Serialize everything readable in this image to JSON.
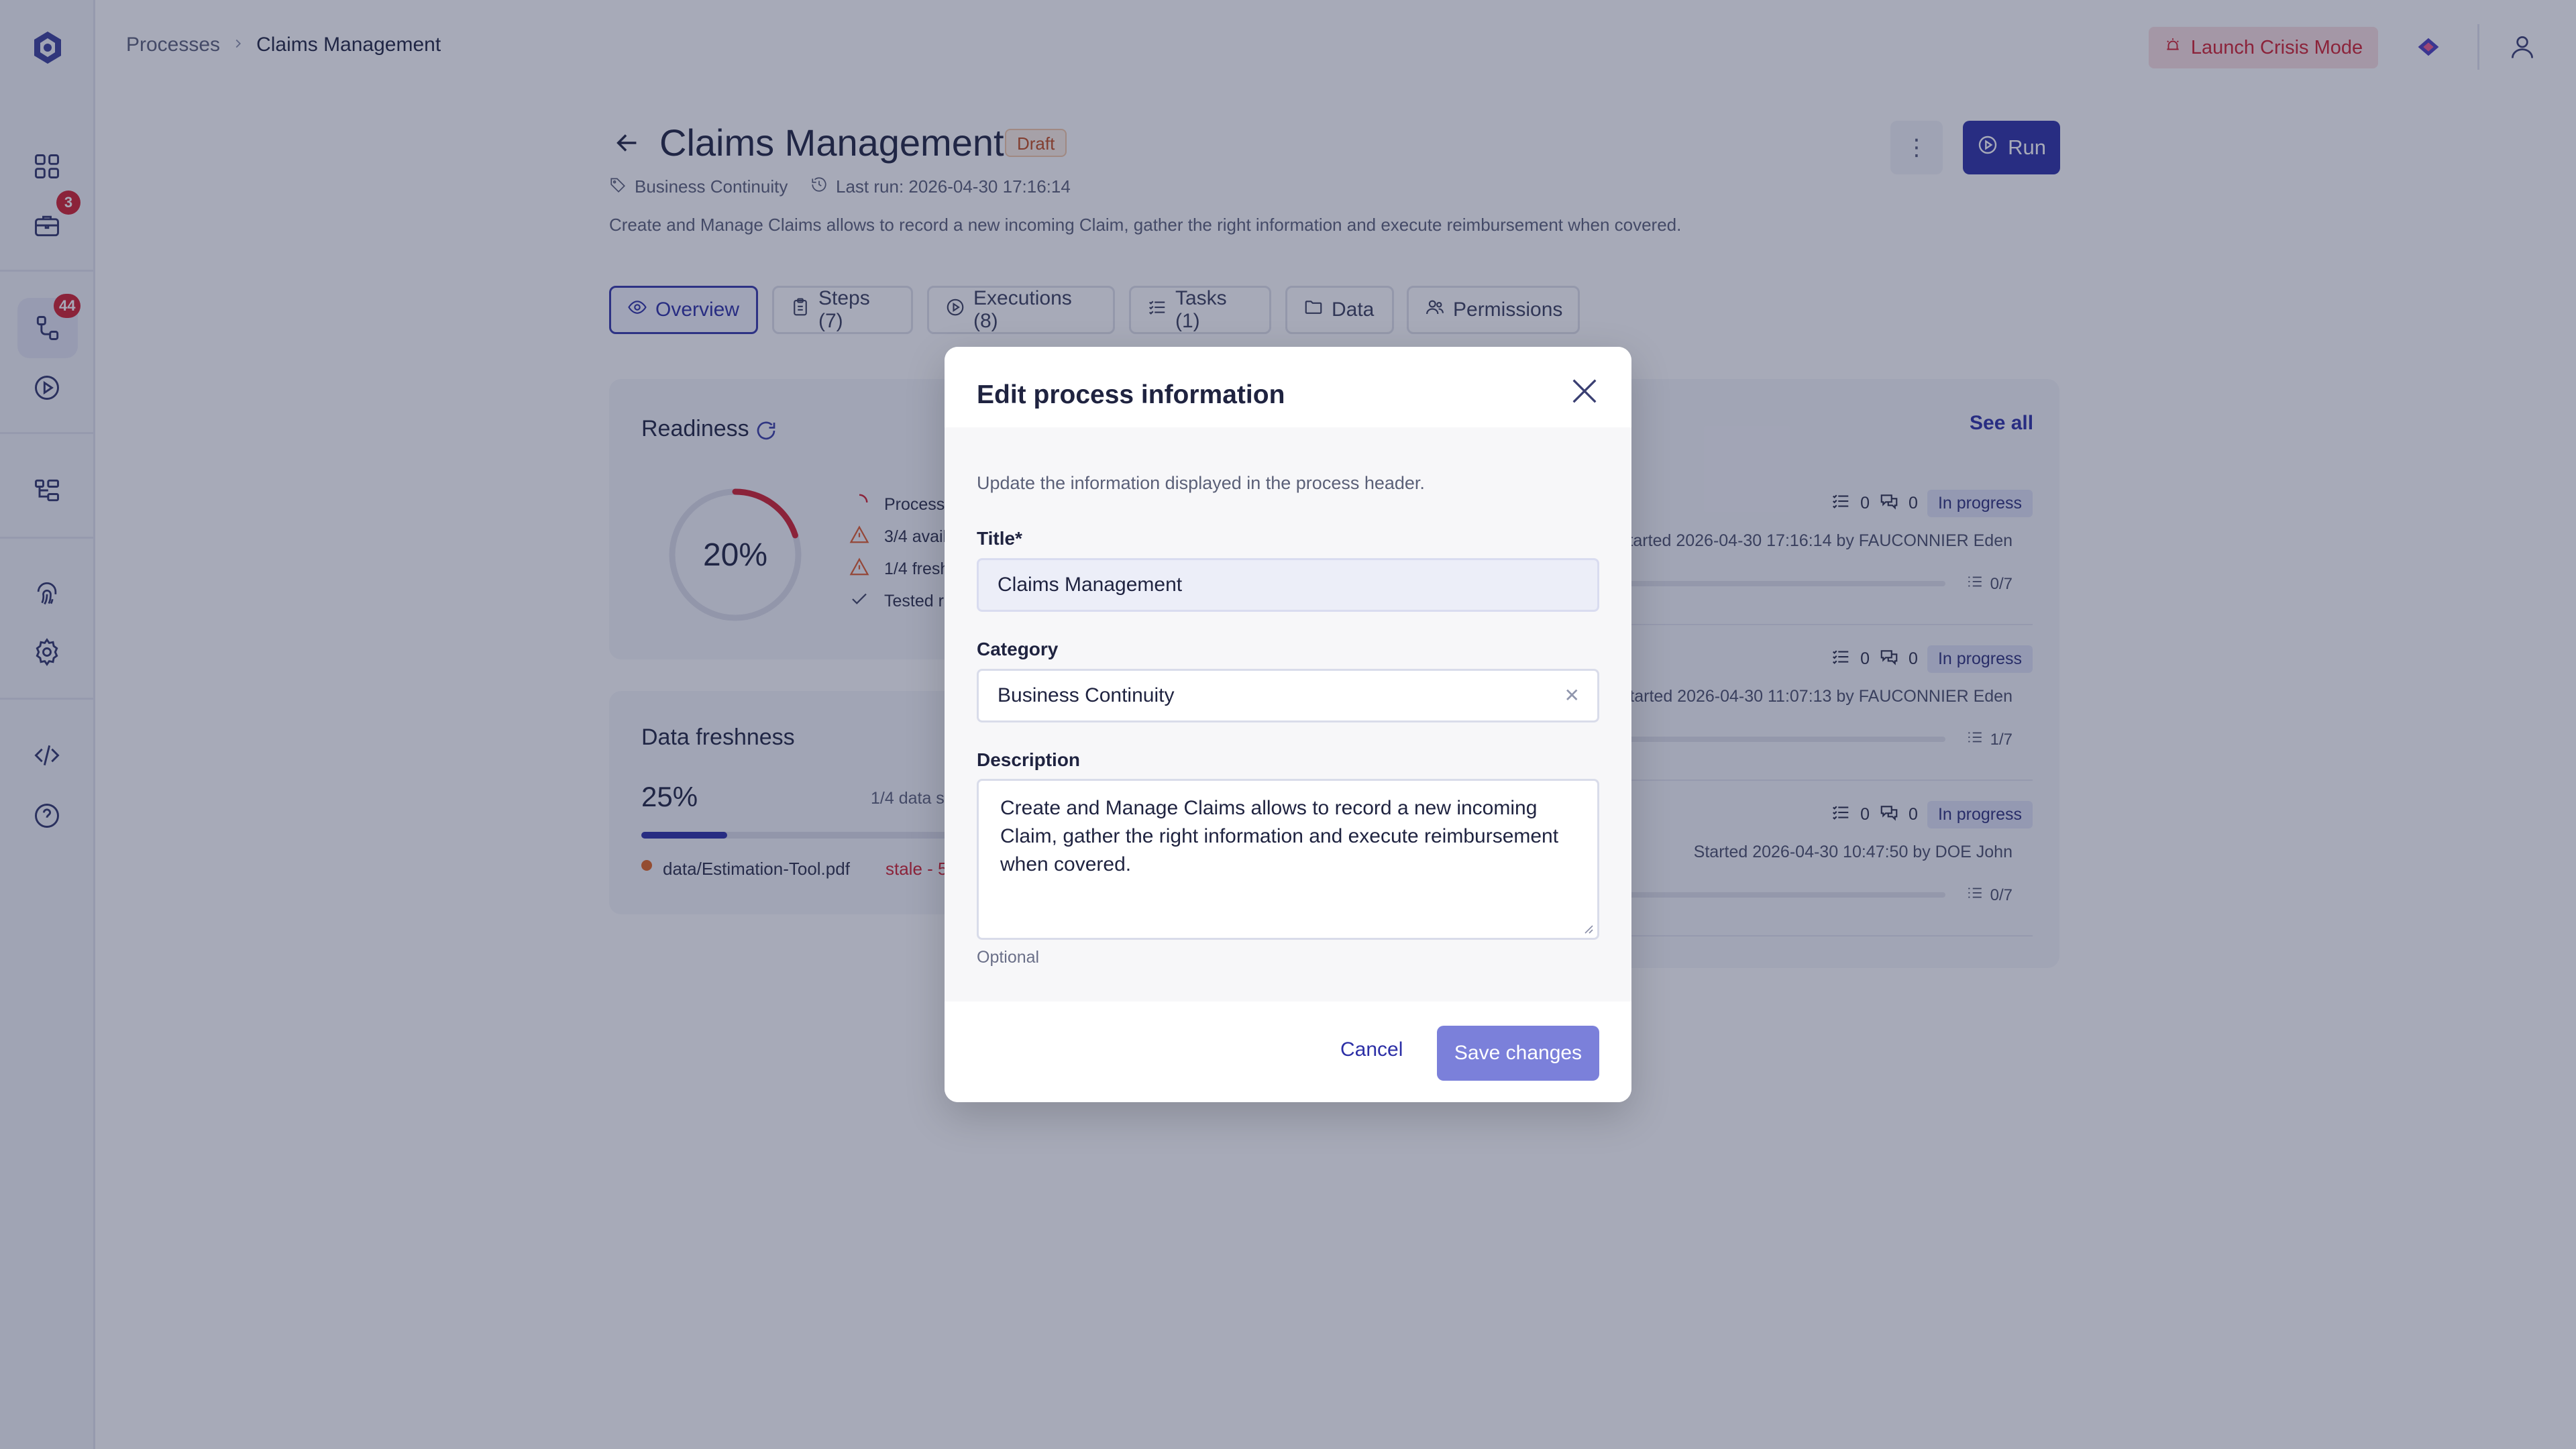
{
  "breadcrumb": {
    "root": "Processes",
    "current": "Claims Management"
  },
  "topbar": {
    "crisis_label": "Launch Crisis Mode"
  },
  "sidebar": {
    "badges": {
      "workspace": "3",
      "processes": "44"
    },
    "items": [
      "dashboard-icon",
      "briefcase-icon",
      "process-icon",
      "play-icon",
      "hierarchy-icon",
      "fingerprint-icon",
      "gear-icon",
      "code-icon",
      "help-icon"
    ]
  },
  "header": {
    "title": "Claims Management",
    "status": "Draft",
    "category": "Business Continuity",
    "last_run": "Last run: 2026-04-30 17:16:14",
    "description": "Create and Manage Claims allows to record a new incoming Claim, gather the right information and execute reimbursement when covered.",
    "run_label": "Run"
  },
  "tabs": [
    {
      "label": "Overview",
      "icon": "eye-icon"
    },
    {
      "label": "Steps (7)",
      "icon": "clipboard-icon"
    },
    {
      "label": "Executions (8)",
      "icon": "play-icon"
    },
    {
      "label": "Tasks (1)",
      "icon": "list-icon"
    },
    {
      "label": "Data",
      "icon": "folder-icon"
    },
    {
      "label": "Permissions",
      "icon": "users-icon"
    }
  ],
  "readiness": {
    "title": "Readiness",
    "percent": "20%",
    "progress": 0.2,
    "items": [
      "Process",
      "3/4 avail",
      "1/4 fresh",
      "Tested r"
    ]
  },
  "freshness": {
    "title": "Data freshness",
    "percent": "25%",
    "progress": 0.25,
    "summary": "1/4 data s",
    "file": "data/Estimation-Tool.pdf",
    "file_status": "stale - 5"
  },
  "executions": {
    "see_all": "See all",
    "rows": [
      {
        "tasks": "0",
        "comments": "0",
        "status": "In progress",
        "started": "tarted 2026-04-30 17:16:14 by FAUCONNIER Eden",
        "steps": "0/7"
      },
      {
        "tasks": "0",
        "comments": "0",
        "status": "In progress",
        "started": "tarted 2026-04-30 11:07:13 by FAUCONNIER Eden",
        "steps": "1/7"
      },
      {
        "tasks": "0",
        "comments": "0",
        "status": "In progress",
        "started": "Started 2026-04-30 10:47:50 by DOE John",
        "steps": "0/7"
      }
    ]
  },
  "modal": {
    "title": "Edit process information",
    "subtitle": "Update the information displayed in the process header.",
    "title_label": "Title*",
    "title_value": "Claims Management",
    "category_label": "Category",
    "category_value": "Business Continuity",
    "description_label": "Description",
    "description_value": "Create and Manage Claims allows to record a new incoming Claim, gather the right information and execute reimbursement when covered.",
    "description_hint": "Optional",
    "cancel_label": "Cancel",
    "save_label": "Save changes"
  }
}
